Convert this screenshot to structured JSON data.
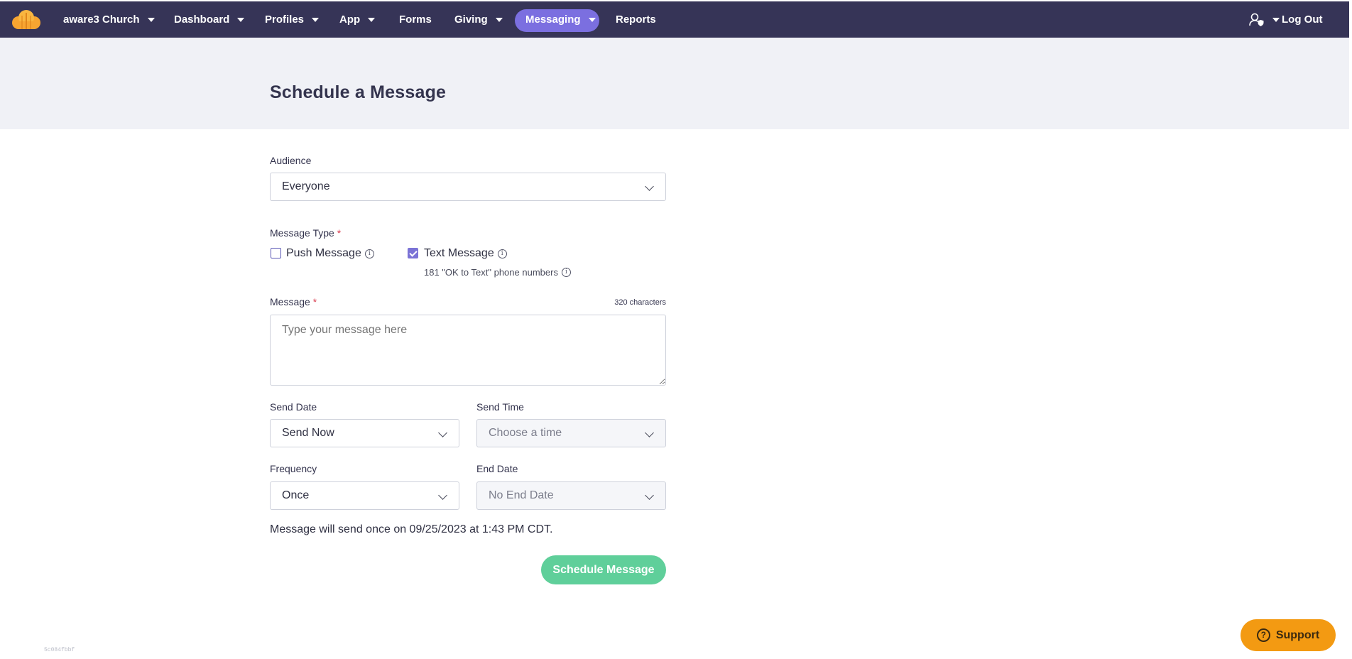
{
  "nav": {
    "org": "aware3 Church",
    "items": [
      "Dashboard",
      "Profiles",
      "App",
      "Forms",
      "Giving",
      "Messaging",
      "Reports"
    ],
    "active": "Messaging",
    "user_icon": "user-shield-icon",
    "logout": "Log Out"
  },
  "page": {
    "title": "Schedule a Message"
  },
  "form": {
    "audience": {
      "label": "Audience",
      "value": "Everyone"
    },
    "message_type": {
      "label": "Message Type",
      "required": "*",
      "push": {
        "label": "Push Message",
        "checked": false
      },
      "text": {
        "label": "Text Message",
        "checked": true
      },
      "text_sub": "181 \"OK to Text\" phone numbers"
    },
    "message": {
      "label": "Message",
      "required": "*",
      "placeholder": "Type your message here",
      "char_count": "320 characters"
    },
    "send_date": {
      "label": "Send Date",
      "value": "Send Now"
    },
    "send_time": {
      "label": "Send Time",
      "value": "Choose a time"
    },
    "frequency": {
      "label": "Frequency",
      "value": "Once"
    },
    "end_date": {
      "label": "End Date",
      "value": "No End Date"
    },
    "summary": "Message will send once on 09/25/2023 at 1:43 PM CDT.",
    "submit": "Schedule Message"
  },
  "support": {
    "label": "Support"
  },
  "version": "5c084fbbf",
  "colors": {
    "nav_bg": "#363457",
    "accent": "#7b6fe0",
    "primary_button": "#5fcf9a",
    "support_button": "#f39a12"
  }
}
